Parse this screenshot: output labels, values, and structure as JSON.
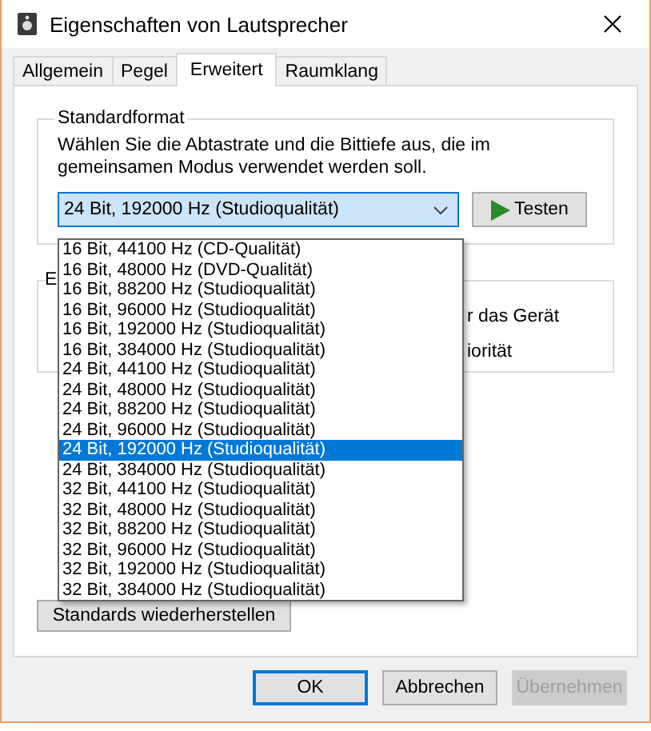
{
  "window": {
    "title": "Eigenschaften von Lautsprecher"
  },
  "tabs": [
    {
      "label": "Allgemein",
      "selected": false
    },
    {
      "label": "Pegel",
      "selected": false
    },
    {
      "label": "Erweitert",
      "selected": true
    },
    {
      "label": "Raumklang",
      "selected": false
    }
  ],
  "standard_format": {
    "title": "Standardformat",
    "description": "Wählen Sie die Abtastrate und die Bittiefe aus, die im gemeinsamen Modus verwendet werden soll.",
    "dropdown": {
      "value": "24 Bit, 192000 Hz (Studioqualität)",
      "expanded": true
    },
    "test_button": "Testen"
  },
  "dropdown_list": [
    {
      "label": "16 Bit, 44100 Hz (CD-Qualität)",
      "selected": false
    },
    {
      "label": "16 Bit, 48000 Hz (DVD-Qualität)",
      "selected": false
    },
    {
      "label": "16 Bit, 88200 Hz (Studioqualität)",
      "selected": false
    },
    {
      "label": "16 Bit, 96000 Hz (Studioqualität)",
      "selected": false
    },
    {
      "label": "16 Bit, 192000 Hz (Studioqualität)",
      "selected": false
    },
    {
      "label": "16 Bit, 384000 Hz (Studioqualität)",
      "selected": false
    },
    {
      "label": "24 Bit, 44100 Hz (Studioqualität)",
      "selected": false
    },
    {
      "label": "24 Bit, 48000 Hz (Studioqualität)",
      "selected": false
    },
    {
      "label": "24 Bit, 88200 Hz (Studioqualität)",
      "selected": false
    },
    {
      "label": "24 Bit, 96000 Hz (Studioqualität)",
      "selected": false
    },
    {
      "label": "24 Bit, 192000 Hz (Studioqualität)",
      "selected": true
    },
    {
      "label": "24 Bit, 384000 Hz (Studioqualität)",
      "selected": false
    },
    {
      "label": "32 Bit, 44100 Hz (Studioqualität)",
      "selected": false
    },
    {
      "label": "32 Bit, 48000 Hz (Studioqualität)",
      "selected": false
    },
    {
      "label": "32 Bit, 88200 Hz (Studioqualität)",
      "selected": false
    },
    {
      "label": "32 Bit, 96000 Hz (Studioqualität)",
      "selected": false
    },
    {
      "label": "32 Bit, 192000 Hz (Studioqualität)",
      "selected": false
    },
    {
      "label": "32 Bit, 384000 Hz (Studioqualität)",
      "selected": false
    }
  ],
  "exclusive_mode": {
    "title": "E",
    "options": [
      "r das Gerät",
      "iorität"
    ]
  },
  "restore_button": "Standards wiederherstellen",
  "buttons": [
    {
      "label": "OK",
      "default": true,
      "disabled": false
    },
    {
      "label": "Abbrechen",
      "default": false,
      "disabled": false
    },
    {
      "label": "Übernehmen",
      "default": false,
      "disabled": true
    }
  ]
}
